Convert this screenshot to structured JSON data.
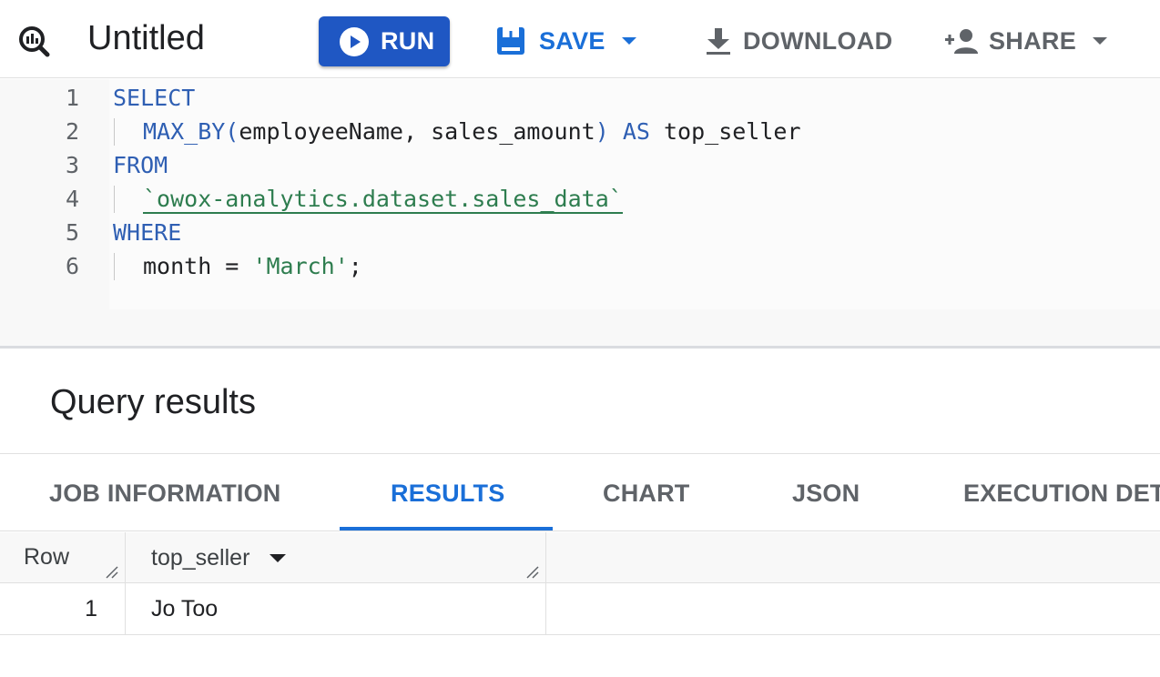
{
  "toolbar": {
    "title": "Untitled",
    "run_label": "RUN",
    "save_label": "SAVE",
    "download_label": "DOWNLOAD",
    "share_label": "SHARE"
  },
  "editor": {
    "lines": [
      {
        "num": "1",
        "tokens": [
          {
            "t": "SELECT",
            "c": "kw"
          }
        ]
      },
      {
        "num": "2",
        "tokens": [
          {
            "t": "MAX_BY(",
            "c": "fn"
          },
          {
            "t": "employeeName, sales_amount",
            "c": "plain"
          },
          {
            "t": ")",
            "c": "fn"
          },
          {
            "t": " AS ",
            "c": "kw"
          },
          {
            "t": "top_seller",
            "c": "plain"
          }
        ]
      },
      {
        "num": "3",
        "tokens": [
          {
            "t": "FROM",
            "c": "kw"
          }
        ]
      },
      {
        "num": "4",
        "tokens": [
          {
            "t": "`owox-analytics.dataset.sales_data`",
            "c": "ref"
          }
        ]
      },
      {
        "num": "5",
        "tokens": [
          {
            "t": "WHERE",
            "c": "kw"
          }
        ]
      },
      {
        "num": "6",
        "tokens": [
          {
            "t": "month = ",
            "c": "plain"
          },
          {
            "t": "'March'",
            "c": "str"
          },
          {
            "t": ";",
            "c": "plain"
          }
        ]
      }
    ]
  },
  "results": {
    "title": "Query results",
    "tabs": [
      {
        "label": "JOB INFORMATION",
        "active": false
      },
      {
        "label": "RESULTS",
        "active": true
      },
      {
        "label": "CHART",
        "active": false
      },
      {
        "label": "JSON",
        "active": false
      },
      {
        "label": "EXECUTION DETAILS",
        "active": false
      }
    ],
    "table": {
      "headers": [
        "Row",
        "top_seller"
      ],
      "rows": [
        [
          "1",
          "Jo Too"
        ]
      ]
    }
  },
  "colors": {
    "accent": "#1a6fd8",
    "run_button": "#1f57c3",
    "keyword": "#2f5fb3",
    "string": "#2e7d4f"
  },
  "icons": {
    "app": "bigquery-icon",
    "run": "play-circle-icon",
    "save": "save-icon",
    "download": "download-icon",
    "share": "person-add-icon"
  }
}
